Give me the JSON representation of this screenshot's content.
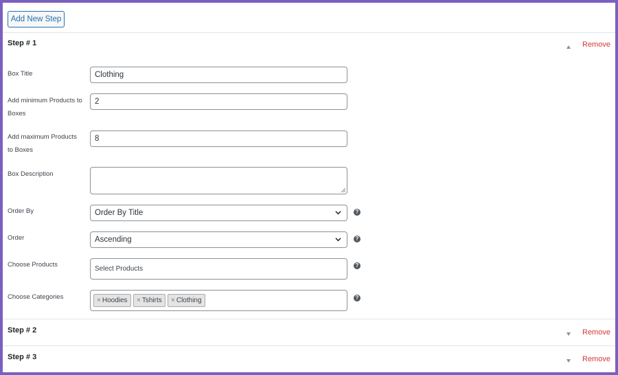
{
  "toolbar": {
    "add_step_label": "Add New Step"
  },
  "steps": [
    {
      "title": "Step # 1",
      "remove_label": "Remove",
      "expanded": true
    },
    {
      "title": "Step # 2",
      "remove_label": "Remove",
      "expanded": false
    },
    {
      "title": "Step # 3",
      "remove_label": "Remove",
      "expanded": false
    }
  ],
  "form": {
    "box_title": {
      "label": "Box Title",
      "value": "Clothing"
    },
    "min_products": {
      "label": "Add minimum Products to Boxes",
      "value": "2"
    },
    "max_products": {
      "label": "Add maximum Products to Boxes",
      "value": "8"
    },
    "box_description": {
      "label": "Box Description",
      "value": ""
    },
    "order_by": {
      "label": "Order By",
      "value": "Order By Title"
    },
    "order": {
      "label": "Order",
      "value": "Ascending"
    },
    "choose_products": {
      "label": "Choose Products",
      "placeholder": "Select Products"
    },
    "choose_categories": {
      "label": "Choose Categories",
      "tags": [
        "Hoodies",
        "Tshirts",
        "Clothing"
      ]
    },
    "help_glyph": "?"
  },
  "icons": {
    "collapse": "chevron-up-icon",
    "expand": "chevron-down-icon",
    "help": "help-icon",
    "remove_tag": "×"
  },
  "colors": {
    "frame": "#7b5fc0",
    "primary": "#2271b1",
    "remove": "#d63638"
  }
}
